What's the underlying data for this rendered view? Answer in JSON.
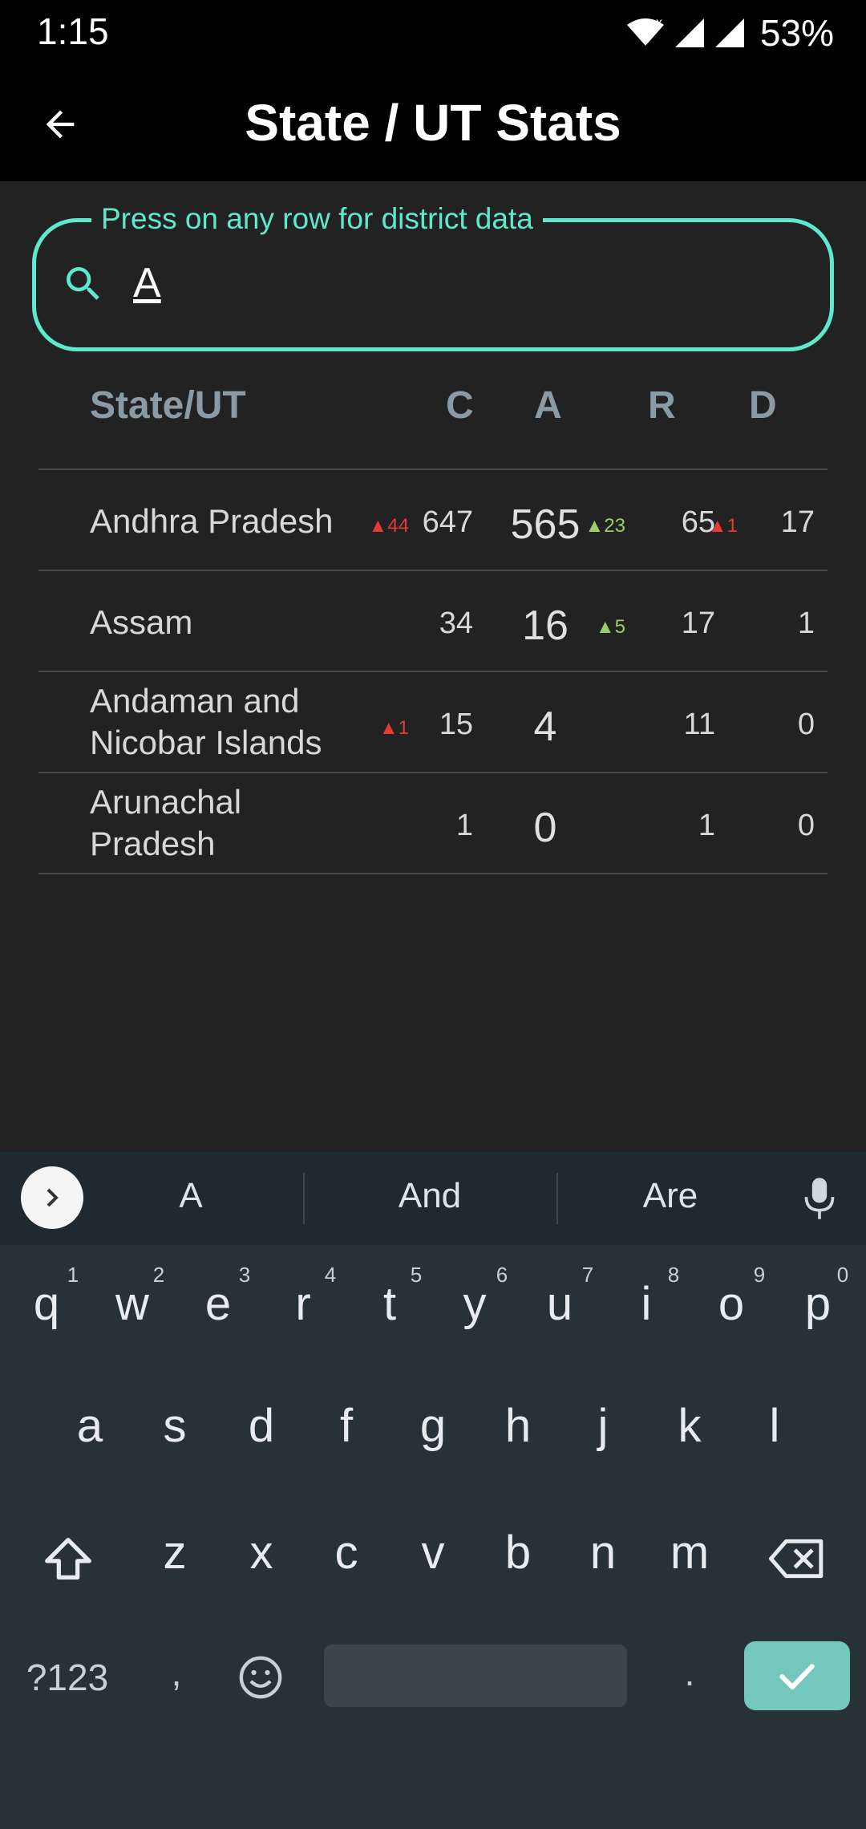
{
  "status_bar": {
    "time": "1:15",
    "battery": "53%"
  },
  "app_bar": {
    "title": "State / UT Stats"
  },
  "search": {
    "legend": "Press on any row for district data",
    "value": "A"
  },
  "table": {
    "headers": {
      "name": "State/UT",
      "c": "C",
      "a": "A",
      "r": "R",
      "d": "D"
    },
    "rows": [
      {
        "name": "Andhra Pradesh",
        "c_delta": "▲44",
        "c": "647",
        "a": "565",
        "r_delta": "▲23",
        "r": "65",
        "d_delta": "▲1",
        "d": "17"
      },
      {
        "name": "Assam",
        "c_delta": "",
        "c": "34",
        "a": "16",
        "r_delta": "▲5",
        "r": "17",
        "d_delta": "",
        "d": "1"
      },
      {
        "name": "Andaman and Nicobar Islands",
        "c_delta": "▲1",
        "c": "15",
        "a": "4",
        "r_delta": "",
        "r": "11",
        "d_delta": "",
        "d": "0"
      },
      {
        "name": "Arunachal Pradesh",
        "c_delta": "",
        "c": "1",
        "a": "0",
        "r_delta": "",
        "r": "1",
        "d_delta": "",
        "d": "0"
      }
    ]
  },
  "keyboard": {
    "suggestions": [
      "A",
      "And",
      "Are"
    ],
    "row1": [
      "q",
      "w",
      "e",
      "r",
      "t",
      "y",
      "u",
      "i",
      "o",
      "p"
    ],
    "row1_hints": [
      "1",
      "2",
      "3",
      "4",
      "5",
      "6",
      "7",
      "8",
      "9",
      "0"
    ],
    "row2": [
      "a",
      "s",
      "d",
      "f",
      "g",
      "h",
      "j",
      "k",
      "l"
    ],
    "row3": [
      "z",
      "x",
      "c",
      "v",
      "b",
      "n",
      "m"
    ],
    "symbols_label": "?123",
    "comma": ",",
    "period": "."
  }
}
